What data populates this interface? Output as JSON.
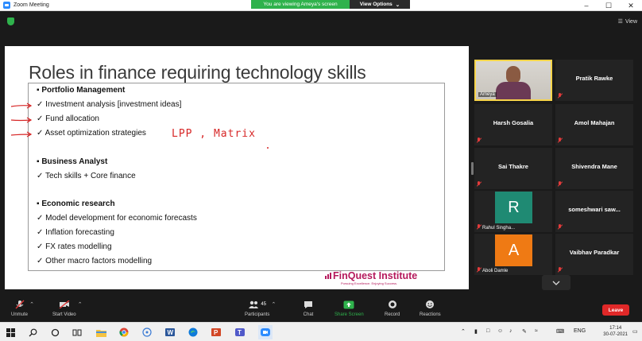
{
  "window": {
    "title": "Zoom Meeting",
    "banner_message": "You are viewing Ameya's screen",
    "view_options_label": "View Options",
    "view_label": "View"
  },
  "slide": {
    "title": "Roles in finance requiring technology skills",
    "sections": [
      {
        "heading": "Portfolio Management",
        "items": [
          "Investment analysis [investment ideas]",
          "Fund allocation",
          "Asset optimization strategies"
        ]
      },
      {
        "heading": "Business Analyst",
        "items": [
          "Tech skills + Core finance"
        ]
      },
      {
        "heading": "Economic research",
        "items": [
          "Model development for economic forecasts",
          "Inflation forecasting",
          "FX rates modelling",
          "Other macro factors modelling"
        ]
      }
    ],
    "annotation": "LPP , Matrix",
    "logo_text": "FinQuest Institute",
    "logo_tagline": "Pursuing Excellence. Enjoying Success."
  },
  "participants": [
    {
      "name": "Ameya",
      "type": "video",
      "active": true
    },
    {
      "name": "Pratik Rawke",
      "type": "name"
    },
    {
      "name": "Harsh Gosalia",
      "type": "name"
    },
    {
      "name": "Amol Mahajan",
      "type": "name"
    },
    {
      "name": "Sai Thakre",
      "type": "name"
    },
    {
      "name": "Shivendra Mane",
      "type": "name"
    },
    {
      "name": "Rahul Singha...",
      "type": "avatar",
      "initial": "R",
      "color": "#1f8a73"
    },
    {
      "name": "someshwari saw...",
      "type": "name"
    },
    {
      "name": "Aboli Damle",
      "type": "avatar",
      "initial": "A",
      "color": "#ef7a14"
    },
    {
      "name": "Vaibhav Paradkar",
      "type": "name"
    }
  ],
  "controls": {
    "unmute": "Unmute",
    "start_video": "Start Video",
    "participants": "Participants",
    "participants_count": "45",
    "chat": "Chat",
    "share_screen": "Share Screen",
    "record": "Record",
    "reactions": "Reactions",
    "leave": "Leave"
  },
  "taskbar": {
    "lang": "ENG",
    "time": "17:14",
    "date": "30-07-2021"
  },
  "colors": {
    "share_green": "#2fb24c",
    "leave_red": "#e02828",
    "active_speaker": "#f7d44a",
    "annotation_red": "#d72626",
    "logo_magenta": "#b5195c"
  }
}
